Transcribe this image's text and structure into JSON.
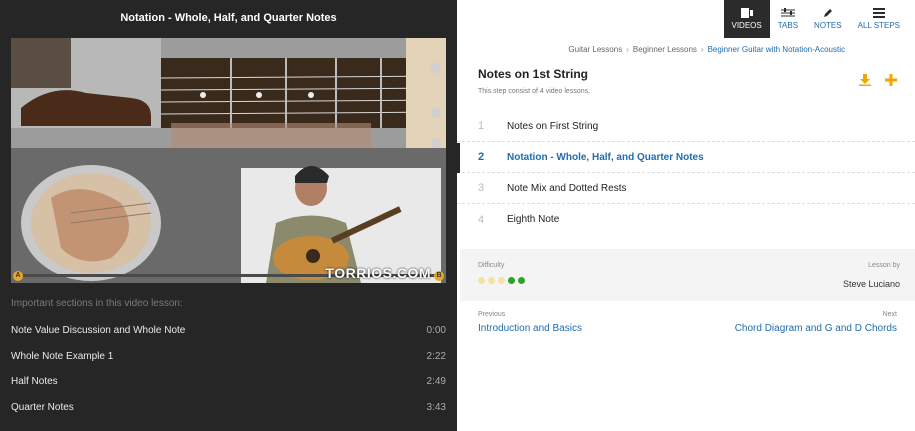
{
  "video": {
    "title": "Notation - Whole, Half, and Quarter Notes",
    "watermark": "TORRIOS.COM",
    "marker_a": "A",
    "marker_b": "B"
  },
  "sections": {
    "heading": "Important sections in this video lesson:",
    "items": [
      {
        "label": "Note Value Discussion and Whole Note",
        "time": "0:00"
      },
      {
        "label": "Whole Note Example 1",
        "time": "2:22"
      },
      {
        "label": "Half Notes",
        "time": "2:49"
      },
      {
        "label": "Quarter Notes",
        "time": "3:43"
      }
    ]
  },
  "tabs": [
    {
      "label": "Videos",
      "icon": "video-icon",
      "active": true
    },
    {
      "label": "Tabs",
      "icon": "tabs-icon",
      "active": false
    },
    {
      "label": "Notes",
      "icon": "pencil-icon",
      "active": false
    },
    {
      "label": "All Steps",
      "icon": "list-icon",
      "active": false
    }
  ],
  "breadcrumb": [
    "Guitar Lessons",
    "Beginner Lessons",
    "Beginner Guitar with Notation-Acoustic"
  ],
  "step": {
    "title": "Notes on 1st String",
    "subtitle": "This step consist of 4 video lessons."
  },
  "lessons": [
    {
      "num": "1",
      "label": "Notes on First String",
      "active": false
    },
    {
      "num": "2",
      "label": "Notation - Whole, Half, and Quarter Notes",
      "active": true
    },
    {
      "num": "3",
      "label": "Note Mix and Dotted Rests",
      "active": false
    },
    {
      "num": "4",
      "label": "Eighth Note",
      "active": false
    }
  ],
  "difficulty": {
    "label": "Difficulty",
    "level": 2,
    "max": 5,
    "dot_colors": [
      "#f3e3a0",
      "#f3e3a0",
      "#f3e3a0",
      "#2aa52a",
      "#2aa52a"
    ]
  },
  "teacher": {
    "label": "Lesson by",
    "name": "Steve Luciano"
  },
  "nav": {
    "prev_label": "Previous",
    "prev_link": "Introduction and Basics",
    "next_label": "Next",
    "next_link": "Chord Diagram and G and D Chords"
  },
  "colors": {
    "accent": "#1f6cb0",
    "download_icon": "#f0a500",
    "dark_panel": "#262626"
  }
}
